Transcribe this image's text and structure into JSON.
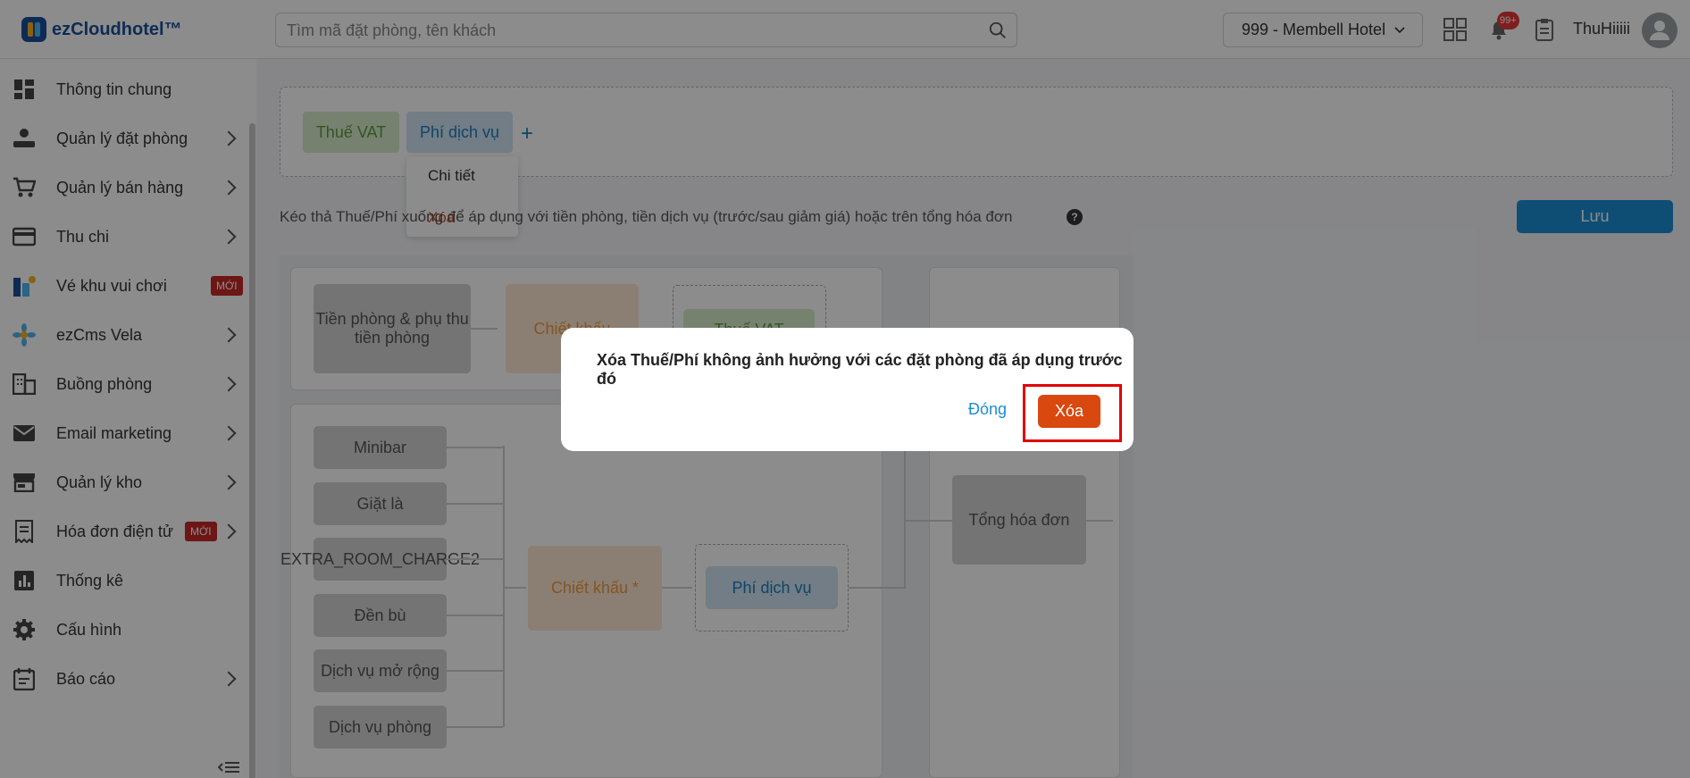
{
  "header": {
    "brand": "ezCloudhotel™",
    "search_placeholder": "Tìm mã đặt phòng, tên khách",
    "hotel": "999 - Membell Hotel",
    "notification_count": "99+",
    "username": "ThuHiiiii"
  },
  "sidebar": {
    "items": [
      {
        "label": "Thông tin chung",
        "icon": "dashboard-icon"
      },
      {
        "label": "Quản lý đặt phòng",
        "icon": "booking-icon"
      },
      {
        "label": "Quản lý bán hàng",
        "icon": "cart-icon"
      },
      {
        "label": "Thu chi",
        "icon": "card-icon"
      },
      {
        "label": "Vé khu vui chơi",
        "icon": "ticket-icon",
        "badge": "MỚI"
      },
      {
        "label": "ezCms Vela",
        "icon": "flower-icon"
      },
      {
        "label": "Buồng phòng",
        "icon": "building-icon"
      },
      {
        "label": "Email marketing",
        "icon": "mail-icon"
      },
      {
        "label": "Quản lý kho",
        "icon": "store-icon"
      },
      {
        "label": "Hóa đơn điện tử",
        "icon": "invoice-icon",
        "badge": "MỚI"
      },
      {
        "label": "Thống kê",
        "icon": "chart-icon"
      },
      {
        "label": "Cấu hình",
        "icon": "settings-icon"
      },
      {
        "label": "Báo cáo",
        "icon": "report-icon"
      }
    ]
  },
  "main": {
    "chips": {
      "vat": "Thuế VAT",
      "fee": "Phí dịch vụ"
    },
    "dropdown": {
      "detail": "Chi tiết",
      "delete": "Xóa"
    },
    "hint": "Kéo thả Thuế/Phí xuống để áp dụng với tiền phòng, tiền dịch vụ (trước/sau giảm giá) hoặc trên tổng hóa đơn",
    "save": "Lưu",
    "flow": {
      "room": "Tiền phòng & phụ thu tiền phòng",
      "discount_top": "Chiết khấu",
      "vat_top": "Thuế VAT",
      "services": [
        "Minibar",
        "Giặt là",
        "EXTRA_ROOM_CHARGE2",
        "Đền bù",
        "Dịch vụ mở rộng",
        "Dịch vụ phòng"
      ],
      "discount_bottom": "Chiết khấu *",
      "fee_bottom": "Phí dịch vụ",
      "total": "Tổng hóa đơn"
    }
  },
  "modal": {
    "message": "Xóa Thuế/Phí không ảnh hưởng với các đặt phòng đã áp dụng trước đó",
    "close": "Đóng",
    "delete": "Xóa"
  }
}
